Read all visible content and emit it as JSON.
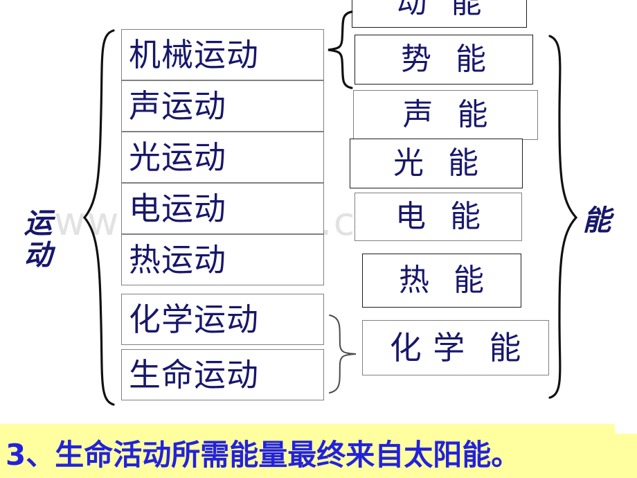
{
  "slide": {
    "background_color": "#ffffff",
    "text_color": "#17176b",
    "banner_color": "#ffffa0",
    "banner_text_color": "#2222dd"
  },
  "watermark": {
    "text": "www.wodocx.com"
  },
  "left_group": {
    "label_chars": [
      "运",
      "动"
    ],
    "label_text": "运动",
    "items": [
      {
        "label": "机械运动"
      },
      {
        "label": "声运动"
      },
      {
        "label": "光运动"
      },
      {
        "label": "电运动"
      },
      {
        "label": "热运动"
      },
      {
        "label": "化学运动"
      },
      {
        "label": "生命运动"
      }
    ]
  },
  "right_group": {
    "label_text": "能",
    "items": [
      {
        "label": "动 能",
        "first": "动",
        "second": "能"
      },
      {
        "label": "势 能",
        "first": "势",
        "second": "能"
      },
      {
        "label": "声 能",
        "first": "声",
        "second": "能"
      },
      {
        "label": "光 能",
        "first": "光",
        "second": "能"
      },
      {
        "label": "电 能",
        "first": "电",
        "second": "能"
      },
      {
        "label": "热 能",
        "first": "热",
        "second": "能"
      },
      {
        "label": "化学 能",
        "first": "化 学",
        "second": "能"
      }
    ]
  },
  "banner": {
    "text": "3、生命活动所需能量最终来自太阳能。"
  }
}
